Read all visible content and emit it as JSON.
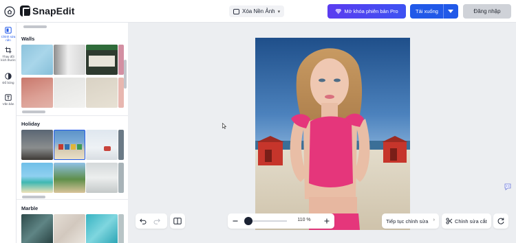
{
  "app": {
    "name": "SnapEdit"
  },
  "toolbar": {
    "tool_select": "Xóa Nền Ảnh",
    "pro_label": "Mở khóa phiên bản Pro",
    "download_label": "Tải xuống",
    "login_label": "Đăng nhập"
  },
  "rail": {
    "items": [
      {
        "label": "Chỉnh sửa nền",
        "icon": "background-edit-icon",
        "active": true
      },
      {
        "label": "Thay đổi kích thước",
        "icon": "crop-icon",
        "active": false
      },
      {
        "label": "Đổ bóng",
        "icon": "shadow-icon",
        "active": false
      },
      {
        "label": "Văn bản",
        "icon": "text-icon",
        "active": false
      }
    ]
  },
  "panel": {
    "sections": [
      {
        "title": "Walls",
        "thumbnails": [
          "blue-wall",
          "white-wall",
          "window-sign",
          "red-wall",
          "light-wall",
          "beige-wall"
        ]
      },
      {
        "title": "Holiday",
        "thumbnails": [
          "street",
          "beach-huts",
          "boats",
          "tropical-beach",
          "palm-beach",
          "snowy-forest"
        ]
      },
      {
        "title": "Marble",
        "thumbnails": [
          "dark-marble",
          "light-marble",
          "blue-marble"
        ]
      }
    ]
  },
  "canvas": {
    "zoom_label": "110 %",
    "zoom_fraction": 0.1
  },
  "bottom": {
    "continue_label": "Tiếp tục chỉnh sửa",
    "cut_label": "Chỉnh sửa cắt"
  },
  "colors": {
    "accent": "#2159e8",
    "pro_gradient_start": "#5b3cf0",
    "pro_gradient_end": "#3d52f2"
  }
}
